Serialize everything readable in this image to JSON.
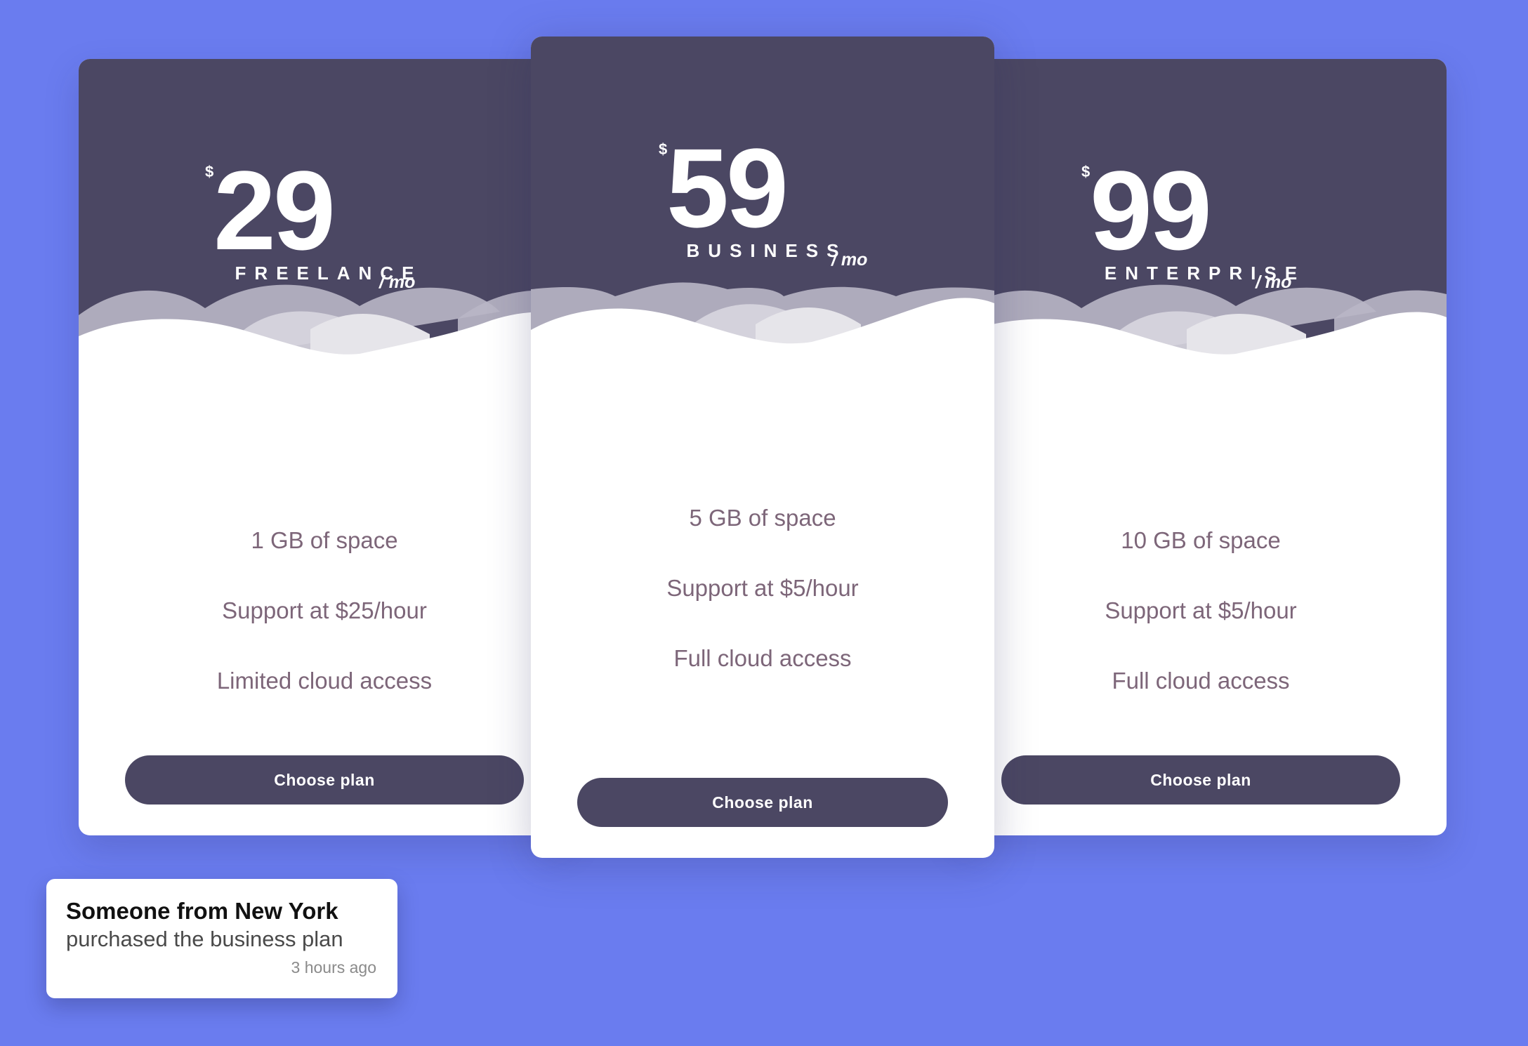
{
  "currency_symbol": "$",
  "period": "/ mo",
  "plans": [
    {
      "amount": "29",
      "name": "FREELANCE",
      "features": [
        "1 GB of space",
        "Support at $25/hour",
        "Limited cloud access"
      ],
      "button": "Choose plan"
    },
    {
      "amount": "59",
      "name": "BUSINESS",
      "features": [
        "5 GB of space",
        "Support at $5/hour",
        "Full cloud access"
      ],
      "button": "Choose plan"
    },
    {
      "amount": "99",
      "name": "ENTERPRISE",
      "features": [
        "10 GB of space",
        "Support at $5/hour",
        "Full cloud access"
      ],
      "button": "Choose plan"
    }
  ],
  "notification": {
    "title": "Someone from New York",
    "message": "purchased the business plan",
    "time": "3 hours ago"
  },
  "colors": {
    "background": "#6a7cef",
    "card_header": "#4b4763",
    "feature_text": "#7d6679",
    "button": "#4b4763"
  }
}
